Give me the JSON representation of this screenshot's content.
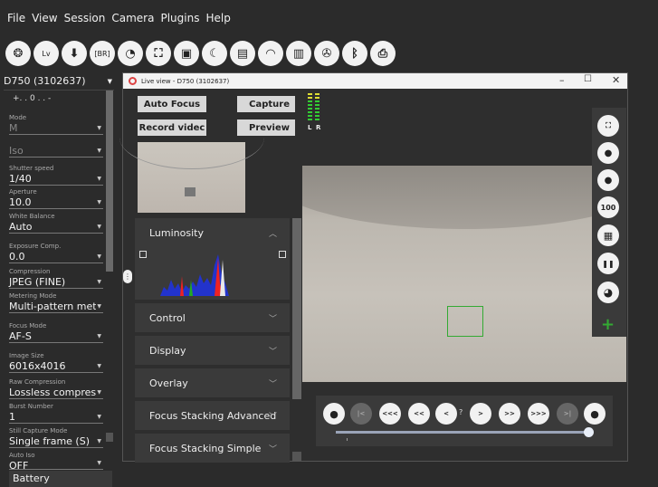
{
  "menu": [
    "File",
    "View",
    "Session",
    "Camera",
    "Plugins",
    "Help"
  ],
  "toolbar": {
    "buttons": [
      {
        "icon": "camera-aperture-icon",
        "glyph": "❂"
      },
      {
        "icon": "live-view-icon",
        "glyph": "Lv"
      },
      {
        "icon": "download-icon",
        "glyph": "⬇"
      },
      {
        "icon": "bracketing-icon",
        "glyph": "[BR]"
      },
      {
        "icon": "timelapse-icon",
        "glyph": "◔"
      },
      {
        "icon": "fullscreen-icon",
        "glyph": "⛶"
      },
      {
        "icon": "gallery-icon",
        "glyph": "▣"
      },
      {
        "icon": "astro-icon",
        "glyph": "☾"
      },
      {
        "icon": "photo-browser-icon",
        "glyph": "▤"
      },
      {
        "icon": "wifi-icon",
        "glyph": "◠"
      },
      {
        "icon": "film-strip-icon",
        "glyph": "▥"
      },
      {
        "icon": "reel-icon",
        "glyph": "✇"
      },
      {
        "icon": "bluetooth-icon",
        "glyph": "ᛒ"
      },
      {
        "icon": "printer-icon",
        "glyph": "⎙"
      }
    ]
  },
  "camera_select": "D750 (3102637)",
  "ev_scale": "+. . 0 . . -",
  "properties": [
    {
      "label": "Mode",
      "value": "M",
      "dim": true
    },
    {
      "label": "",
      "value": "Iso",
      "dim": true
    },
    {
      "label": "Shutter speed",
      "value": "1/40"
    },
    {
      "label": "Aperture",
      "value": "10.0"
    },
    {
      "label": "White Balance",
      "value": "Auto"
    },
    {
      "label": "Exposure Comp.",
      "value": "0.0"
    },
    {
      "label": "Compression",
      "value": "JPEG (FINE)"
    },
    {
      "label": "Metering Mode",
      "value": "Multi-pattern meter"
    },
    {
      "label": "Focus Mode",
      "value": "AF-S"
    },
    {
      "label": "Image Size",
      "value": "6016x4016"
    },
    {
      "label": "Raw Compression",
      "value": "Lossless compresse"
    },
    {
      "label": "Burst Number",
      "value": "1"
    },
    {
      "label": "Still Capture Mode",
      "value": "Single frame (S)"
    },
    {
      "label": "Auto Iso",
      "value": "OFF"
    }
  ],
  "battery": "Battery",
  "liveview": {
    "title": "Live view - D750 (3102637)",
    "window_controls": {
      "minimize": "–",
      "maximize": "☐",
      "close": "✕"
    },
    "buttons": {
      "auto_focus": "Auto Focus",
      "capture": "Capture",
      "record_video": "Record videc",
      "preview": "Preview"
    },
    "vu_labels": {
      "left": "L",
      "right": "R"
    },
    "accordion": [
      {
        "label": "Luminosity",
        "chev": "︿"
      },
      {
        "label": "Control",
        "chev": "﹀"
      },
      {
        "label": "Display",
        "chev": "﹀"
      },
      {
        "label": "Overlay",
        "chev": "﹀"
      },
      {
        "label": "Focus Stacking Advanced",
        "chev": "﹀"
      },
      {
        "label": "Focus Stacking Simple",
        "chev": "﹀"
      }
    ],
    "right_tools": [
      {
        "icon": "fullscreen-icon",
        "glyph": "⛶"
      },
      {
        "icon": "zoom-out-icon",
        "glyph": "🔍"
      },
      {
        "icon": "zoom-in-icon",
        "glyph": "🔍"
      },
      {
        "icon": "zoom-100-icon",
        "glyph": "100"
      },
      {
        "icon": "grid-icon",
        "glyph": "▦"
      },
      {
        "icon": "pause-icon",
        "glyph": "❚❚"
      },
      {
        "icon": "timer-icon",
        "glyph": "◕"
      }
    ],
    "plus": "+",
    "nav_buttons": [
      {
        "icon": "lock-icon",
        "glyph": "🔒",
        "dim": false
      },
      {
        "icon": "first-icon",
        "glyph": "|<",
        "dim": true
      },
      {
        "icon": "fast-back-icon",
        "glyph": "<<<",
        "dim": false
      },
      {
        "icon": "back-icon",
        "glyph": "<<",
        "dim": false
      },
      {
        "icon": "step-back-icon",
        "glyph": "<",
        "dim": false
      },
      {
        "icon": "step-forward-icon",
        "glyph": ">",
        "dim": false
      },
      {
        "icon": "forward-icon",
        "glyph": ">>",
        "dim": false
      },
      {
        "icon": "fast-forward-icon",
        "glyph": ">>>",
        "dim": false
      },
      {
        "icon": "last-icon",
        "glyph": ">|",
        "dim": true
      },
      {
        "icon": "lock-icon",
        "glyph": "🔒",
        "dim": false
      }
    ],
    "nav_question": "?"
  }
}
